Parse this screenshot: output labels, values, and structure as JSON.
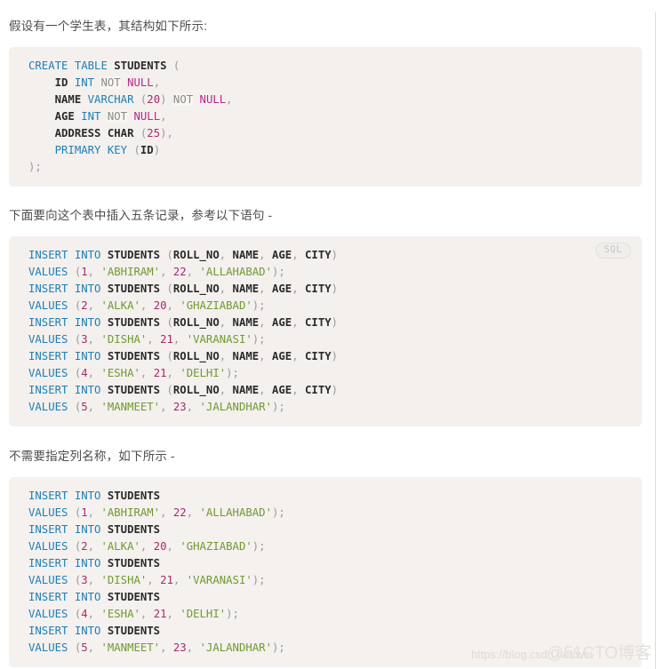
{
  "document": {
    "paragraphs": {
      "intro": "假设有一个学生表，其结构如下所示:",
      "insert_five": "下面要向这个表中插入五条记录，参考以下语句 -",
      "no_columns": "不需要指定列名称，如下所示 -"
    },
    "code_blocks": [
      {
        "id": "create-table",
        "language_badge": null,
        "lines": [
          "CREATE TABLE STUDENTS (",
          "    ID INT NOT NULL,",
          "    NAME VARCHAR (20) NOT NULL,",
          "    AGE INT NOT NULL,",
          "    ADDRESS CHAR (25),",
          "    PRIMARY KEY (ID)",
          ");"
        ]
      },
      {
        "id": "insert-with-columns",
        "language_badge": "SQL",
        "lines": [
          "INSERT INTO STUDENTS (ROLL_NO, NAME, AGE, CITY)",
          "VALUES (1, 'ABHIRAM', 22, 'ALLAHABAD');",
          "INSERT INTO STUDENTS (ROLL_NO, NAME, AGE, CITY)",
          "VALUES (2, 'ALKA', 20, 'GHAZIABAD');",
          "INSERT INTO STUDENTS (ROLL_NO, NAME, AGE, CITY)",
          "VALUES (3, 'DISHA', 21, 'VARANASI');",
          "INSERT INTO STUDENTS (ROLL_NO, NAME, AGE, CITY)",
          "VALUES (4, 'ESHA', 21, 'DELHI');",
          "INSERT INTO STUDENTS (ROLL_NO, NAME, AGE, CITY)",
          "VALUES (5, 'MANMEET', 23, 'JALANDHAR');"
        ]
      },
      {
        "id": "insert-without-columns",
        "language_badge": null,
        "lines": [
          "INSERT INTO STUDENTS",
          "VALUES (1, 'ABHIRAM', 22, 'ALLAHABAD');",
          "INSERT INTO STUDENTS",
          "VALUES (2, 'ALKA', 20, 'GHAZIABAD');",
          "INSERT INTO STUDENTS",
          "VALUES (3, 'DISHA', 21, 'VARANASI');",
          "INSERT INTO STUDENTS",
          "VALUES (4, 'ESHA', 21, 'DELHI');",
          "INSERT INTO STUDENTS",
          "VALUES (5, 'MANMEET', 23, 'JALANDHAR');"
        ]
      }
    ],
    "table_schema": {
      "table_name": "STUDENTS",
      "columns": [
        {
          "name": "ID",
          "type": "INT",
          "constraint": "NOT NULL"
        },
        {
          "name": "NAME",
          "type": "VARCHAR (20)",
          "constraint": "NOT NULL"
        },
        {
          "name": "AGE",
          "type": "INT",
          "constraint": "NOT NULL"
        },
        {
          "name": "ADDRESS",
          "type": "CHAR (25)",
          "constraint": ""
        }
      ],
      "primary_key": "ID"
    },
    "inserted_rows": {
      "columns": [
        "ROLL_NO",
        "NAME",
        "AGE",
        "CITY"
      ],
      "values": [
        [
          1,
          "ABHIRAM",
          22,
          "ALLAHABAD"
        ],
        [
          2,
          "ALKA",
          20,
          "GHAZIABAD"
        ],
        [
          3,
          "DISHA",
          21,
          "VARANASI"
        ],
        [
          4,
          "ESHA",
          21,
          "DELHI"
        ],
        [
          5,
          "MANMEET",
          23,
          "JALANDHAR"
        ]
      ]
    },
    "watermark": {
      "url": "https://blog.csdn.net/wei",
      "brand": "@51CTO博客"
    },
    "colors": {
      "keyword": "#1f7fb6",
      "string": "#6f9b2f",
      "number": "#a52a6e",
      "null_keyword": "#b5288c",
      "not_keyword": "#8a8a8a",
      "entity": "#2b2b2b",
      "punctuation": "#9a9a9a",
      "code_background": "#f3f0ee",
      "text": "#4d4d4d"
    }
  }
}
